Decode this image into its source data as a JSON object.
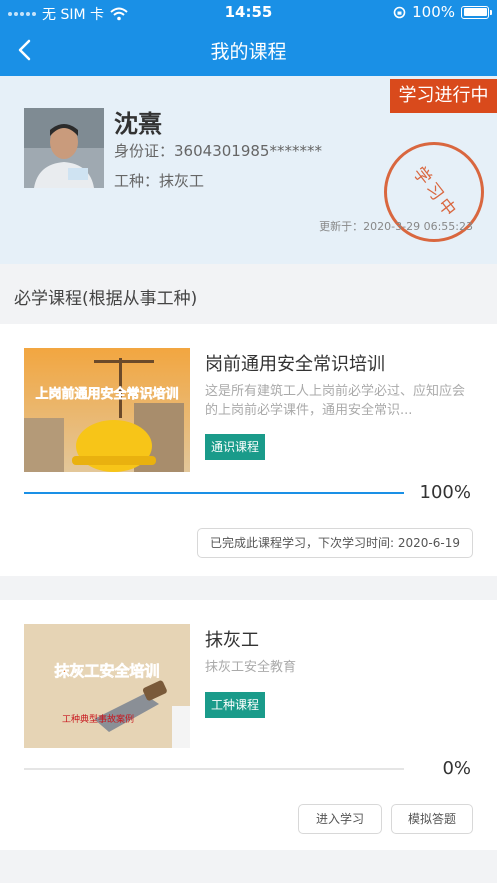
{
  "status_bar": {
    "carrier": "无 SIM 卡",
    "time": "14:55",
    "battery": "100%",
    "battery_level": 1.0
  },
  "nav": {
    "title": "我的课程"
  },
  "profile": {
    "name": "沈熹",
    "id_label": "身份证：",
    "id_number": "3604301985*******",
    "type_label": "工种：",
    "type_value": "抹灰工",
    "ribbon": "学习进行中",
    "stamp": "学习中",
    "updated_label": "更新于：",
    "updated_time": "2020-3-29 06:55:23"
  },
  "section": {
    "title": "必学课程(根据从事工种)"
  },
  "courses": [
    {
      "title": "岗前通用安全常识培训",
      "description": "这是所有建筑工人上岗前必学必过、应知应会的上岗前必学课件，通用安全常识...",
      "tag": "通识课程",
      "thumb_text": "上岗前通用安全常识培训",
      "progress": 1.0,
      "progress_label": "100%",
      "status_text": "已完成此课程学习，下次学习时间: 2020-6-19"
    },
    {
      "title": "抹灰工",
      "description": "抹灰工安全教育",
      "tag": "工种课程",
      "thumb_text": "抹灰工安全培训",
      "thumb_sub": "工种典型事故案例",
      "progress": 0.0,
      "progress_label": "0%",
      "buttons": {
        "enter": "进入学习",
        "mock": "模拟答题"
      }
    }
  ],
  "colors": {
    "primary": "#1a90e6",
    "ribbon": "#d94a1c",
    "stamp": "#d9673f",
    "tag": "#1a9b8a",
    "profile_bg": "#e6f0f8"
  },
  "icons": [
    "back-arrow-icon",
    "wifi-icon",
    "rotation-lock-icon",
    "battery-icon"
  ]
}
